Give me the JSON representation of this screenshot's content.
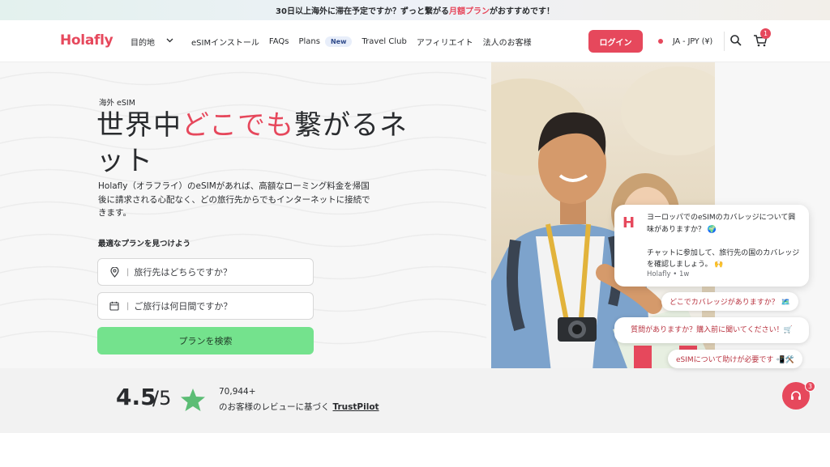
{
  "announcement": {
    "text_before": "30日以上海外に滞在予定ですか？ずっと繋がる",
    "highlight": "月額プラン",
    "text_after": "がおすすめです！"
  },
  "header": {
    "logo": "Holafly",
    "nav": {
      "destinations": "目的地",
      "esim_install": "eSIMインストール",
      "faqs": "FAQs",
      "plans": "Plans",
      "plans_badge": "New",
      "travel_club": "Travel Club",
      "affiliate": "アフィリエイト",
      "business": "法人のお客様"
    },
    "login": "ログイン",
    "locale": "JA - JPY (¥)",
    "cart_count": "1"
  },
  "hero": {
    "eyebrow": "海外 eSIM",
    "headline_part1": "世界中",
    "headline_accent": "どこでも",
    "headline_part2": "繋がるネット",
    "description": "Holafly（オラフライ）のeSIMがあれば、高額なローミング料金を帰国後に請求される心配なく、どの旅行先からでもインターネットに接続できます。",
    "find_label": "最適なプランを見つけよう",
    "destination_placeholder": "旅行先はどちらですか？",
    "days_placeholder": "ご旅行は何日間ですか？",
    "search_button": "プランを検索"
  },
  "rating": {
    "score": "4.5",
    "out_of": "/5",
    "count": "70,944+",
    "based_on": "のお客様のレビューに基づく",
    "provider": "TrustPilot"
  },
  "chat": {
    "message": "ヨーロッパでのeSIMのカバレッジについて興味がありますか？ 🌍\n\nチャットに参加して、旅行先の国のカバレッジを確認しましょう。 🙌",
    "meta": "Holafly • 1w",
    "chips": [
      "どこでカバレッジがありますか？ 🗺️",
      "質問がありますか？購入前に聞いてください！🛒",
      "eSIMについて助けが必要です 📲🛠️"
    ],
    "unread": "3"
  },
  "colors": {
    "brand": "#e6485c",
    "cta_green": "#74e28d"
  }
}
